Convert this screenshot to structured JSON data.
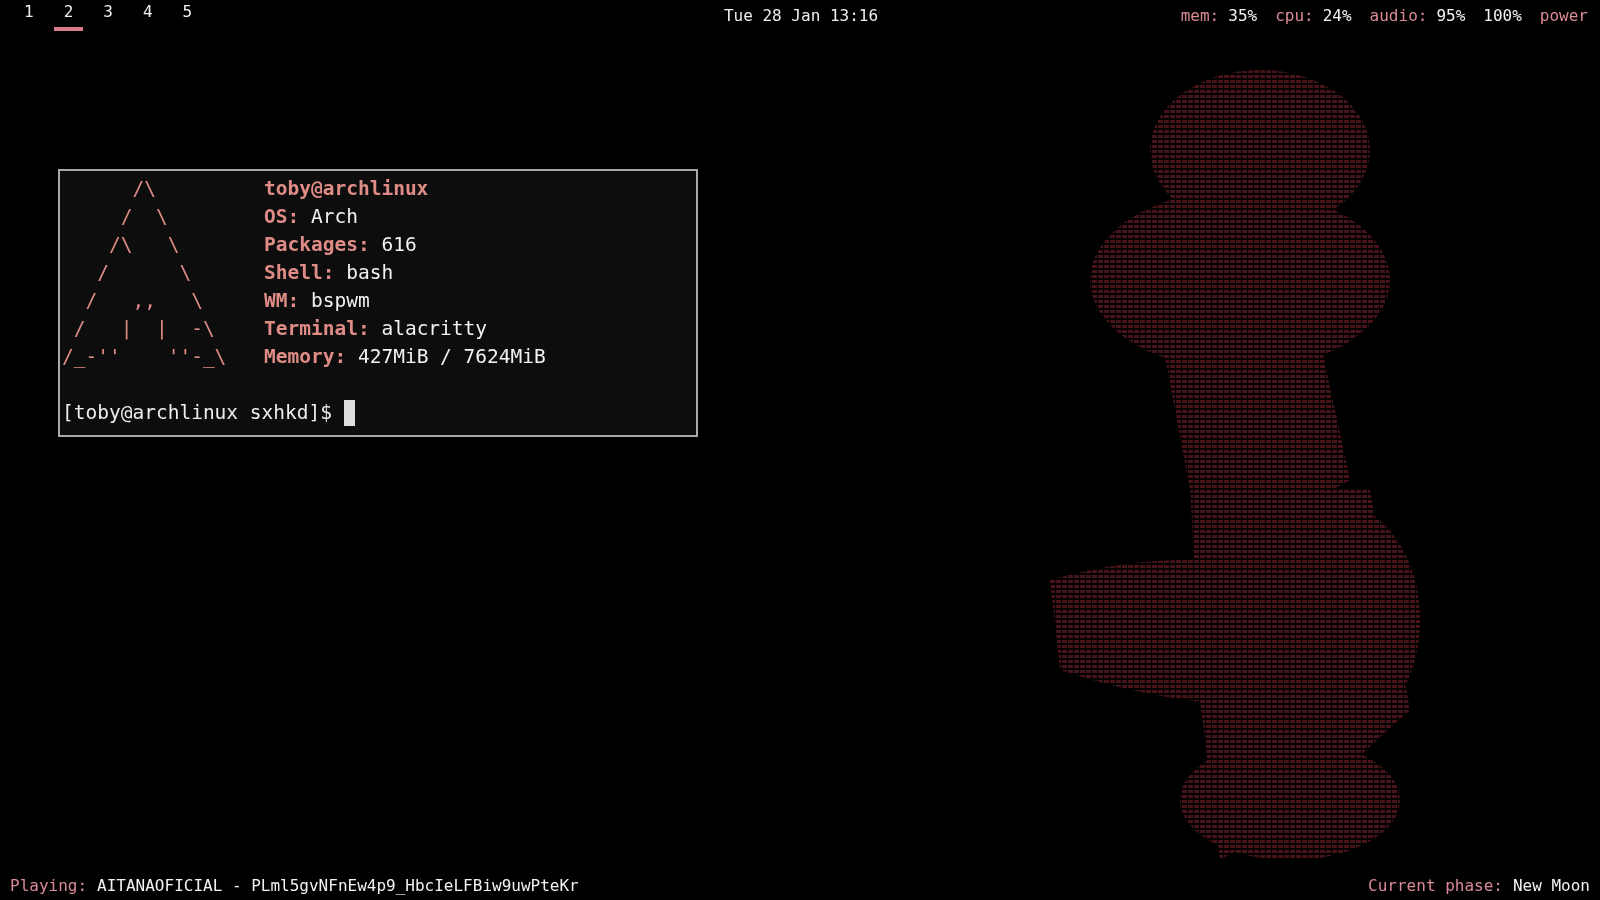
{
  "top_bar": {
    "workspaces": [
      {
        "label": "1",
        "selected": false
      },
      {
        "label": "2",
        "selected": true
      },
      {
        "label": "3",
        "selected": false
      },
      {
        "label": "4",
        "selected": false
      },
      {
        "label": "5",
        "selected": false
      }
    ],
    "clock": "Tue 28 Jan 13:16",
    "status": [
      {
        "label": "mem:",
        "value": "35%"
      },
      {
        "label": "cpu:",
        "value": "24%"
      },
      {
        "label": "audio:",
        "value": "95%"
      },
      {
        "value": "100%"
      },
      {
        "label": "power"
      }
    ]
  },
  "terminal": {
    "logo": [
      "      /\\",
      "     /  \\",
      "    /\\   \\",
      "   /      \\",
      "  /   ,,   \\",
      " /   |  |  -\\",
      "/_-''    ''-_\\"
    ],
    "title": "toby@archlinux",
    "info": [
      {
        "label": "OS:",
        "value": "Arch"
      },
      {
        "label": "Packages:",
        "value": "616"
      },
      {
        "label": "Shell:",
        "value": "bash"
      },
      {
        "label": "WM:",
        "value": "bspwm"
      },
      {
        "label": "Terminal:",
        "value": "alacritty"
      },
      {
        "label": "Memory:",
        "value": "427MiB / 7624MiB"
      }
    ],
    "prompt": "[toby@archlinux sxhkd]$"
  },
  "bottom_bar": {
    "left": {
      "label": "Playing:",
      "value": "AITANAOFICIAL - PLml5gvNFnEw4p9_HbcIeLFBiw9uwPteKr"
    },
    "right": {
      "label": "Current phase:",
      "value": "New Moon"
    }
  }
}
